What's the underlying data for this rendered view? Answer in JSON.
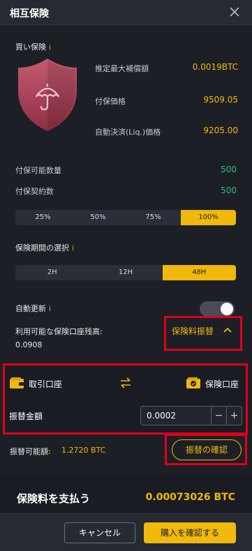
{
  "dialog": {
    "title": "相互保険"
  },
  "buy_insurance": {
    "label": "買い保険",
    "info": "i",
    "rows": [
      {
        "label": "推定最大補償額",
        "value": "0.0019BTC",
        "color": "#f0b90b"
      },
      {
        "label": "付保価格",
        "value": "9509.05",
        "color": "#f0b90b"
      },
      {
        "label": "自動決済(Liq.)価格",
        "value": "9205.00",
        "color": "#f0b90b"
      }
    ]
  },
  "insurable": {
    "qty_label": "付保可能数量",
    "qty_value": "500",
    "contracts_label": "付保契約数",
    "contracts_value": "500"
  },
  "percent_options": {
    "items": [
      "25%",
      "50%",
      "75%",
      "100%"
    ],
    "selected": "100%"
  },
  "period": {
    "label": "保険期間の選択",
    "info": "i",
    "options": [
      "2H",
      "12H",
      "48H"
    ],
    "selected": "48H"
  },
  "auto_renew": {
    "label": "自動更新",
    "info": "i",
    "enabled": false
  },
  "balance": {
    "label": "利用可能な保険口座残高:",
    "value": "0.0908"
  },
  "premium_transfer": {
    "label": "保険料振替"
  },
  "transfer": {
    "from_account": "取引口座",
    "to_account": "保険口座",
    "amount_label": "振替金額",
    "amount_value": "0.0002",
    "minus": "−",
    "plus": "+"
  },
  "transferable": {
    "label": "振替可能額:",
    "value": "1.2720 BTC"
  },
  "confirm_transfer": {
    "label": "振替の確認"
  },
  "pay": {
    "label": "保険料を支払う",
    "value": "0.00073026 BTC"
  },
  "footer": {
    "cancel_label": "キャンセル",
    "confirm_label": "購入を確認する"
  },
  "colors": {
    "accent": "#f0b90b",
    "positive": "#2ebd85",
    "highlight_box": "#e0001a",
    "shield": "#b8455f"
  }
}
